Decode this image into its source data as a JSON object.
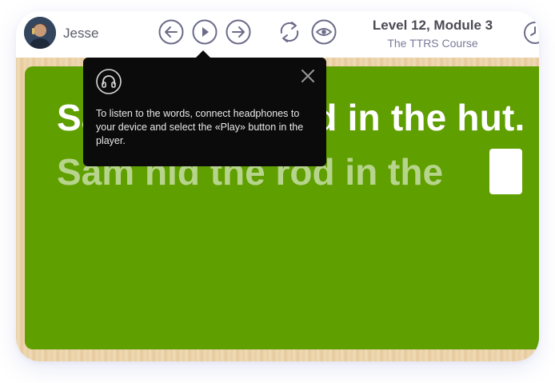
{
  "header": {
    "user_name": "Jesse",
    "title": "Level 12, Module 3",
    "subtitle": "The TTRS Course",
    "icons": {
      "back": "arrow-left-icon",
      "play": "play-icon",
      "forward": "arrow-right-icon",
      "repeat": "repeat-icon",
      "show": "eye-icon"
    },
    "icon_color": "#6b6b8a"
  },
  "board": {
    "sentence": "Sam hid the rod in the hut.",
    "sentence_partial": "Sam hid the rod in the",
    "board_color": "#5f9f00"
  },
  "tooltip": {
    "icon": "headphones-icon",
    "text": "To listen to the words, connect headphones to your device and select the «Play» button in the player."
  }
}
